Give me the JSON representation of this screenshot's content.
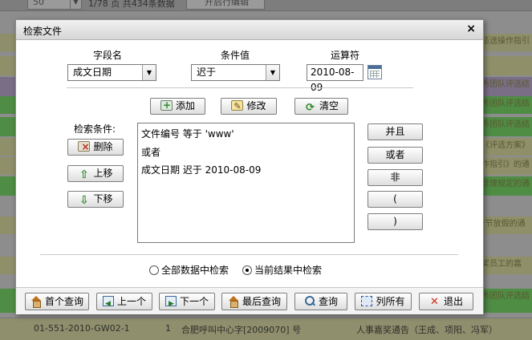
{
  "background": {
    "page_size": "50",
    "page_info": "1/78 页  共434条数据",
    "edit_button": "开启行编辑",
    "right_snippets": [
      "适送操作指引",
      "秀团队评选结",
      "秀团队评选结",
      "秀团队评选结",
      "秀团队评选结",
      "《评选方案》",
      "作指引》的通",
      "管理规定的通",
      "\"节放假的通",
      "奖员工的嘉",
      "秀团队评选结"
    ],
    "bottom_row": {
      "doc_no": "01-551-2010-GW02-1",
      "count": "1",
      "issuer": "合肥呼叫中心字[2009070] 号",
      "title": "人事嘉奖通告（王成、项阳、冯军）"
    }
  },
  "dialog": {
    "title": "检索文件",
    "close": "×",
    "field_name_label": "字段名",
    "condition_value_label": "条件值",
    "operator_label": "运算符",
    "field_name_value": "成文日期",
    "condition_value": "迟于",
    "operator_value": "2010-08-09",
    "add_button": "添加",
    "modify_button": "修改",
    "clear_button": "清空",
    "conditions_label": "检索条件:",
    "delete_button": "删除",
    "move_up_button": "上移",
    "move_down_button": "下移",
    "conditions": [
      "文件编号 等于 'www'",
      "或者",
      "成文日期 迟于 2010-08-09"
    ],
    "and_button": "并且",
    "or_button": "或者",
    "not_button": "非",
    "lparen_button": "(",
    "rparen_button": ")",
    "search_scope_all": "全部数据中检索",
    "search_scope_current": "当前结果中检索",
    "search_scope_selected": "current"
  },
  "footer": {
    "first": "首个查询",
    "prev": "上一个",
    "next": "下一个",
    "last": "最后查询",
    "query": "查询",
    "list_all": "列所有",
    "exit": "退出"
  }
}
